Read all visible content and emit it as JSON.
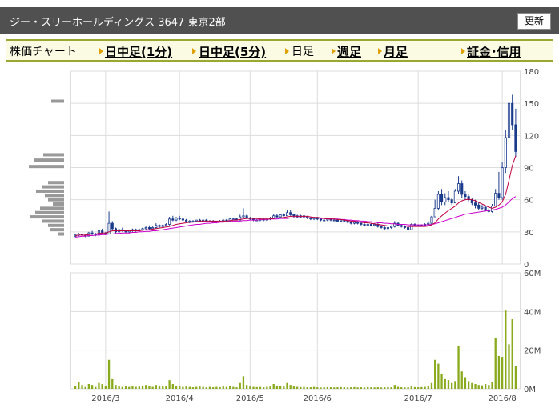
{
  "header": {
    "title": "ジー・スリーホールディングス 3647 東京2部",
    "refresh_label": "更新"
  },
  "nav": {
    "chart_label": "株価チャート",
    "intraday_1m": "日中足(1分)",
    "intraday_5m": "日中足(5分)",
    "daily": "日足",
    "weekly": "週足",
    "monthly": "月足",
    "margin": "証金･信用"
  },
  "colors": {
    "candle": "#1a3a8c",
    "ma_short": "#c00040",
    "ma_long": "#cc00cc",
    "volume": "#8aaa1e",
    "volume_profile": "#999999",
    "accent": "#9aa832"
  },
  "chart_data": {
    "type": "candlestick",
    "price_axis": {
      "min": 0,
      "max": 180,
      "ticks": [
        "0",
        "30",
        "60",
        "90",
        "120",
        "150",
        "180"
      ]
    },
    "volume_axis": {
      "min": 0,
      "max": 60,
      "unit": "M",
      "ticks": [
        "0M",
        "20M",
        "40M",
        "60M"
      ]
    },
    "x_labels": [
      "2016/3",
      "2016/4",
      "2016/5",
      "2016/6",
      "2016/7",
      "2016/8"
    ],
    "candles": [
      [
        26,
        28,
        25,
        27
      ],
      [
        27,
        29,
        26,
        28
      ],
      [
        28,
        30,
        26,
        27
      ],
      [
        27,
        28,
        25,
        26
      ],
      [
        26,
        30,
        26,
        29
      ],
      [
        29,
        31,
        27,
        28
      ],
      [
        28,
        29,
        26,
        27
      ],
      [
        27,
        32,
        27,
        31
      ],
      [
        31,
        33,
        28,
        29
      ],
      [
        29,
        30,
        27,
        28
      ],
      [
        28,
        49,
        28,
        38
      ],
      [
        38,
        40,
        31,
        33
      ],
      [
        33,
        34,
        29,
        30
      ],
      [
        30,
        33,
        29,
        32
      ],
      [
        32,
        34,
        30,
        31
      ],
      [
        31,
        32,
        29,
        30
      ],
      [
        30,
        32,
        29,
        31
      ],
      [
        31,
        33,
        30,
        32
      ],
      [
        32,
        33,
        30,
        31
      ],
      [
        31,
        33,
        30,
        32
      ],
      [
        32,
        34,
        31,
        33
      ],
      [
        33,
        35,
        32,
        34
      ],
      [
        34,
        36,
        32,
        33
      ],
      [
        33,
        35,
        32,
        34
      ],
      [
        34,
        38,
        33,
        36
      ],
      [
        36,
        37,
        34,
        35
      ],
      [
        35,
        37,
        34,
        36
      ],
      [
        36,
        38,
        35,
        37
      ],
      [
        37,
        44,
        36,
        42
      ],
      [
        42,
        45,
        40,
        41
      ],
      [
        41,
        44,
        40,
        43
      ],
      [
        43,
        45,
        41,
        42
      ],
      [
        42,
        43,
        40,
        41
      ],
      [
        41,
        42,
        39,
        40
      ],
      [
        40,
        41,
        38,
        40
      ],
      [
        40,
        41,
        39,
        40
      ],
      [
        40,
        41,
        39,
        41
      ],
      [
        41,
        42,
        40,
        40
      ],
      [
        40,
        42,
        39,
        41
      ],
      [
        41,
        42,
        40,
        40
      ],
      [
        40,
        41,
        39,
        40
      ],
      [
        40,
        41,
        38,
        39
      ],
      [
        39,
        40,
        38,
        40
      ],
      [
        40,
        41,
        39,
        40
      ],
      [
        40,
        42,
        39,
        41
      ],
      [
        41,
        42,
        40,
        40
      ],
      [
        40,
        43,
        40,
        42
      ],
      [
        42,
        43,
        41,
        42
      ],
      [
        42,
        43,
        41,
        41
      ],
      [
        41,
        46,
        41,
        44
      ],
      [
        44,
        52,
        43,
        45
      ],
      [
        45,
        47,
        42,
        43
      ],
      [
        43,
        44,
        41,
        42
      ],
      [
        42,
        43,
        40,
        41
      ],
      [
        41,
        42,
        40,
        41
      ],
      [
        41,
        43,
        40,
        42
      ],
      [
        42,
        43,
        40,
        41
      ],
      [
        41,
        43,
        40,
        42
      ],
      [
        42,
        44,
        41,
        43
      ],
      [
        43,
        47,
        42,
        45
      ],
      [
        45,
        47,
        43,
        44
      ],
      [
        44,
        47,
        43,
        46
      ],
      [
        46,
        48,
        44,
        45
      ],
      [
        45,
        50,
        45,
        48
      ],
      [
        48,
        50,
        45,
        46
      ],
      [
        46,
        47,
        43,
        45
      ],
      [
        45,
        46,
        43,
        44
      ],
      [
        44,
        46,
        43,
        45
      ],
      [
        45,
        46,
        43,
        44
      ],
      [
        44,
        45,
        42,
        43
      ],
      [
        43,
        44,
        41,
        42
      ],
      [
        42,
        44,
        41,
        43
      ],
      [
        43,
        44,
        41,
        42
      ],
      [
        42,
        43,
        40,
        41
      ],
      [
        41,
        42,
        40,
        41
      ],
      [
        41,
        43,
        40,
        42
      ],
      [
        42,
        43,
        40,
        41
      ],
      [
        41,
        42,
        40,
        41
      ],
      [
        41,
        42,
        39,
        40
      ],
      [
        40,
        42,
        39,
        41
      ],
      [
        41,
        42,
        39,
        40
      ],
      [
        40,
        41,
        38,
        39
      ],
      [
        39,
        40,
        37,
        38
      ],
      [
        38,
        40,
        37,
        39
      ],
      [
        39,
        40,
        37,
        38
      ],
      [
        38,
        39,
        36,
        37
      ],
      [
        37,
        38,
        35,
        36
      ],
      [
        36,
        38,
        35,
        37
      ],
      [
        37,
        38,
        35,
        36
      ],
      [
        36,
        38,
        35,
        37
      ],
      [
        37,
        38,
        34,
        35
      ],
      [
        35,
        36,
        33,
        34
      ],
      [
        34,
        35,
        32,
        33
      ],
      [
        33,
        35,
        32,
        34
      ],
      [
        34,
        36,
        33,
        35
      ],
      [
        35,
        40,
        34,
        38
      ],
      [
        38,
        39,
        35,
        36
      ],
      [
        36,
        37,
        34,
        35
      ],
      [
        35,
        36,
        33,
        34
      ],
      [
        34,
        35,
        31,
        32
      ],
      [
        32,
        38,
        32,
        37
      ],
      [
        37,
        38,
        35,
        36
      ],
      [
        36,
        37,
        35,
        36
      ],
      [
        36,
        37,
        35,
        36
      ],
      [
        36,
        38,
        35,
        37
      ],
      [
        37,
        40,
        36,
        38
      ],
      [
        38,
        45,
        36,
        44
      ],
      [
        44,
        60,
        44,
        52
      ],
      [
        52,
        68,
        50,
        65
      ],
      [
        65,
        70,
        55,
        58
      ],
      [
        58,
        66,
        55,
        62
      ],
      [
        62,
        68,
        58,
        60
      ],
      [
        60,
        62,
        55,
        57
      ],
      [
        57,
        70,
        57,
        68
      ],
      [
        68,
        82,
        65,
        75
      ],
      [
        75,
        78,
        62,
        65
      ],
      [
        65,
        68,
        60,
        63
      ],
      [
        63,
        65,
        58,
        60
      ],
      [
        60,
        62,
        55,
        57
      ],
      [
        57,
        60,
        52,
        55
      ],
      [
        55,
        58,
        50,
        52
      ],
      [
        52,
        55,
        50,
        53
      ],
      [
        53,
        54,
        49,
        50
      ],
      [
        50,
        52,
        48,
        49
      ],
      [
        49,
        56,
        48,
        54
      ],
      [
        54,
        70,
        54,
        66
      ],
      [
        66,
        86,
        60,
        62
      ],
      [
        62,
        95,
        60,
        90
      ],
      [
        90,
        125,
        85,
        118
      ],
      [
        118,
        160,
        110,
        150
      ],
      [
        150,
        158,
        125,
        130
      ],
      [
        130,
        145,
        100,
        105
      ]
    ],
    "volume": [
      1.5,
      3.5,
      2,
      1,
      2.5,
      2,
      1,
      3,
      2.5,
      1.5,
      15,
      5,
      2,
      1.5,
      1,
      1.2,
      1,
      1.5,
      1,
      1.2,
      1.5,
      2,
      1.3,
      1,
      2,
      1.5,
      1.2,
      1.5,
      4.5,
      2.5,
      1.5,
      1.3,
      1,
      1.2,
      1,
      0.8,
      1,
      1.2,
      1,
      0.8,
      1,
      0.8,
      1,
      0.9,
      1.2,
      1,
      1.5,
      1,
      0.8,
      3,
      6.5,
      2,
      1.2,
      1,
      0.9,
      1,
      0.8,
      1,
      1.2,
      2.5,
      1.5,
      1.5,
      1.2,
      3,
      2,
      1.2,
      1,
      0.9,
      1,
      0.8,
      0.8,
      1,
      0.8,
      0.7,
      0.8,
      0.9,
      0.8,
      0.7,
      0.8,
      0.9,
      0.8,
      0.7,
      0.8,
      0.9,
      0.7,
      0.8,
      0.7,
      0.9,
      0.8,
      0.7,
      0.8,
      0.7,
      0.8,
      0.9,
      0.8,
      2,
      1,
      0.8,
      0.7,
      0.8,
      1.2,
      0.9,
      0.8,
      0.9,
      1,
      1.5,
      3,
      15,
      13,
      7.5,
      5,
      4.5,
      3,
      4,
      22,
      9,
      6,
      4,
      3,
      2.5,
      2,
      1.8,
      2.5,
      2,
      3.5,
      26.5,
      17,
      16.5,
      40.5,
      23,
      36,
      12
    ],
    "ma_short": [
      26.5,
      27,
      27,
      27,
      27.5,
      28,
      28,
      28.5,
      29,
      29,
      30,
      31,
      31,
      31,
      31,
      31,
      31,
      31,
      31,
      31,
      31.5,
      32,
      32,
      32.5,
      33,
      33.5,
      34,
      34.5,
      35,
      36,
      37,
      37.5,
      38,
      38.5,
      39,
      39,
      39.5,
      40,
      40,
      40,
      40,
      40,
      40,
      40,
      40,
      40,
      40.5,
      41,
      41,
      41.5,
      42,
      42.5,
      42.5,
      42.5,
      42.5,
      42,
      42,
      42,
      42,
      42.5,
      43,
      43,
      43.5,
      44,
      44.5,
      44.5,
      44.5,
      44.5,
      44.5,
      44.5,
      44,
      43.5,
      43.5,
      43,
      42.5,
      42,
      42,
      42,
      41.5,
      41.5,
      41,
      40.5,
      40,
      40,
      39.5,
      39,
      38.5,
      38.5,
      38,
      37.5,
      37,
      36.5,
      36,
      35.5,
      35.5,
      35.5,
      35.5,
      35.5,
      35.5,
      35,
      35,
      35,
      35,
      35,
      35,
      35.5,
      36.5,
      38.5,
      42,
      45,
      47.5,
      50,
      52,
      54,
      57,
      59,
      60,
      60.5,
      60,
      59,
      57.5,
      56,
      54.5,
      53,
      52,
      53,
      55,
      58,
      65,
      78,
      92,
      101
    ],
    "ma_long": [
      25,
      25.5,
      26,
      26,
      26.5,
      26.5,
      27,
      27,
      27.5,
      27.5,
      28,
      28,
      28.5,
      28.5,
      29,
      29,
      29,
      29.5,
      29.5,
      30,
      30,
      30.5,
      30.5,
      31,
      31,
      31.5,
      32,
      32.5,
      33,
      33.5,
      34,
      34.5,
      35,
      35.5,
      36,
      36.5,
      37,
      37,
      37.5,
      38,
      38,
      38.5,
      38.5,
      39,
      39,
      39.5,
      39.5,
      40,
      40,
      40,
      40.5,
      40.5,
      41,
      41,
      41,
      41.5,
      41.5,
      41.5,
      42,
      42,
      42,
      42.5,
      42.5,
      42.5,
      43,
      43,
      43,
      43,
      43,
      43,
      43,
      43,
      43,
      42.5,
      42.5,
      42.5,
      42,
      42,
      42,
      41.5,
      41.5,
      41,
      41,
      40.5,
      40.5,
      40,
      40,
      39.5,
      39.5,
      39,
      38.5,
      38.5,
      38,
      38,
      37.5,
      37.5,
      37,
      37,
      37,
      36.5,
      36.5,
      36.5,
      36.5,
      36.5,
      36.5,
      36.5,
      37,
      37.5,
      38.5,
      39.5,
      40.5,
      41.5,
      42.5,
      43.5,
      44.5,
      45.5,
      46.5,
      47,
      47.5,
      48,
      48.5,
      49,
      49.5,
      50,
      50.5,
      51,
      52,
      53,
      55,
      58,
      61,
      63
    ],
    "volume_profile": [
      [
        152,
        16
      ],
      [
        102,
        26
      ],
      [
        97,
        38
      ],
      [
        91,
        44
      ],
      [
        76,
        20
      ],
      [
        72,
        28
      ],
      [
        68,
        35
      ],
      [
        64,
        24
      ],
      [
        60,
        20
      ],
      [
        56,
        14
      ],
      [
        52,
        30
      ],
      [
        48,
        36
      ],
      [
        44,
        42
      ],
      [
        40,
        28
      ],
      [
        36,
        20
      ],
      [
        32,
        18
      ],
      [
        28,
        8
      ]
    ]
  }
}
